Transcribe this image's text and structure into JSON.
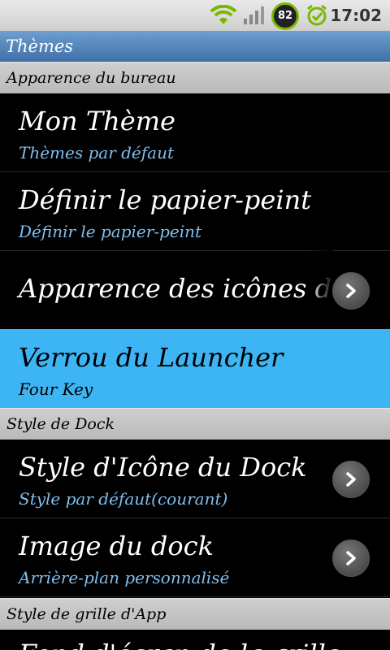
{
  "status_bar": {
    "battery": "82",
    "time": "17:02"
  },
  "title_bar": {
    "title": "Thèmes"
  },
  "sections": [
    {
      "label": "Apparence du bureau"
    },
    {
      "label": "Style de Dock"
    },
    {
      "label": "Style de grille d'App"
    }
  ],
  "rows": [
    {
      "label": "Mon Thème",
      "sublabel": "Thèmes par défaut"
    },
    {
      "label": "Définir le papier-peint",
      "sublabel": "Définir le papier-peint"
    },
    {
      "label": "Apparence des icônes du"
    },
    {
      "label": "Verrou du Launcher",
      "sublabel": "Four Key",
      "highlighted": true
    },
    {
      "label": "Style d'Icône du Dock",
      "sublabel": "Style par défaut(courant)"
    },
    {
      "label": "Image du dock",
      "sublabel": "Arrière-plan personnalisé"
    },
    {
      "label": "Fond d'écran de la grille"
    }
  ],
  "colors": {
    "accent": "#3db5f4",
    "title_bar": "#4f80b8",
    "sublabel": "#7fbff0"
  }
}
